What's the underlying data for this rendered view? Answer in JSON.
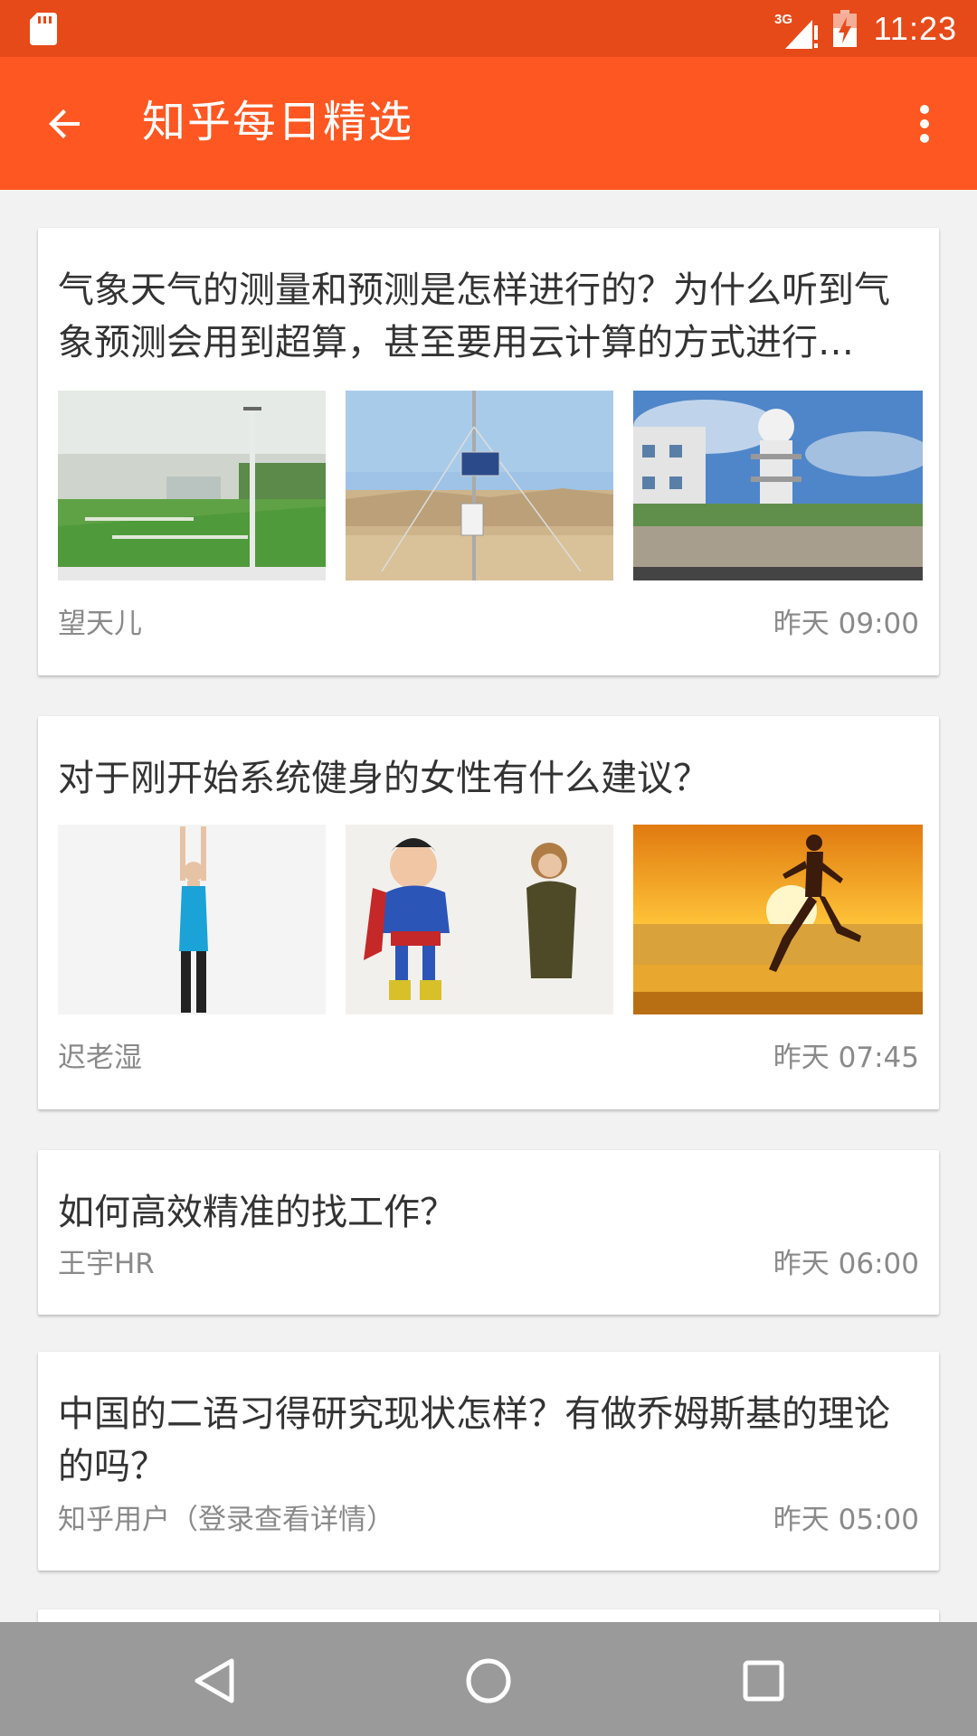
{
  "status_bar": {
    "time": "11:23",
    "network": "3G",
    "icons": [
      "sd-card-icon",
      "signal-3g-icon",
      "battery-charging-icon"
    ]
  },
  "app_bar": {
    "title": "知乎每日精选",
    "back_icon": "arrow-back-icon",
    "menu_icon": "more-vert-icon"
  },
  "feed": [
    {
      "title": "气象天气的测量和预测是怎样进行的？为什么听到气象预测会用到超算，甚至要用云计算的方式进行…",
      "author": "望天儿",
      "time": "昨天 09:00",
      "images": [
        "weather-station-field",
        "solar-weather-mast",
        "observatory-tower"
      ]
    },
    {
      "title": "对于刚开始系统健身的女性有什么建议？",
      "author": "迟老湿",
      "time": "昨天 07:45",
      "images": [
        "woman-arms-raised",
        "cartoon-superhero",
        "runner-at-sunset"
      ]
    },
    {
      "title": "如何高效精准的找工作？",
      "author": "王宇HR",
      "time": "昨天 06:00",
      "images": []
    },
    {
      "title": "中国的二语习得研究现状怎样？有做乔姆斯基的理论的吗？",
      "author": "知乎用户（登录查看详情）",
      "time": "昨天 05:00",
      "images": []
    }
  ],
  "nav_bar": {
    "buttons": [
      "back-triangle-icon",
      "home-circle-icon",
      "recents-square-icon"
    ]
  },
  "colors": {
    "status_bar": "#e64a19",
    "app_bar": "#ff5722",
    "background": "#f2f2f2",
    "nav_bar": "#9a9a9a"
  }
}
